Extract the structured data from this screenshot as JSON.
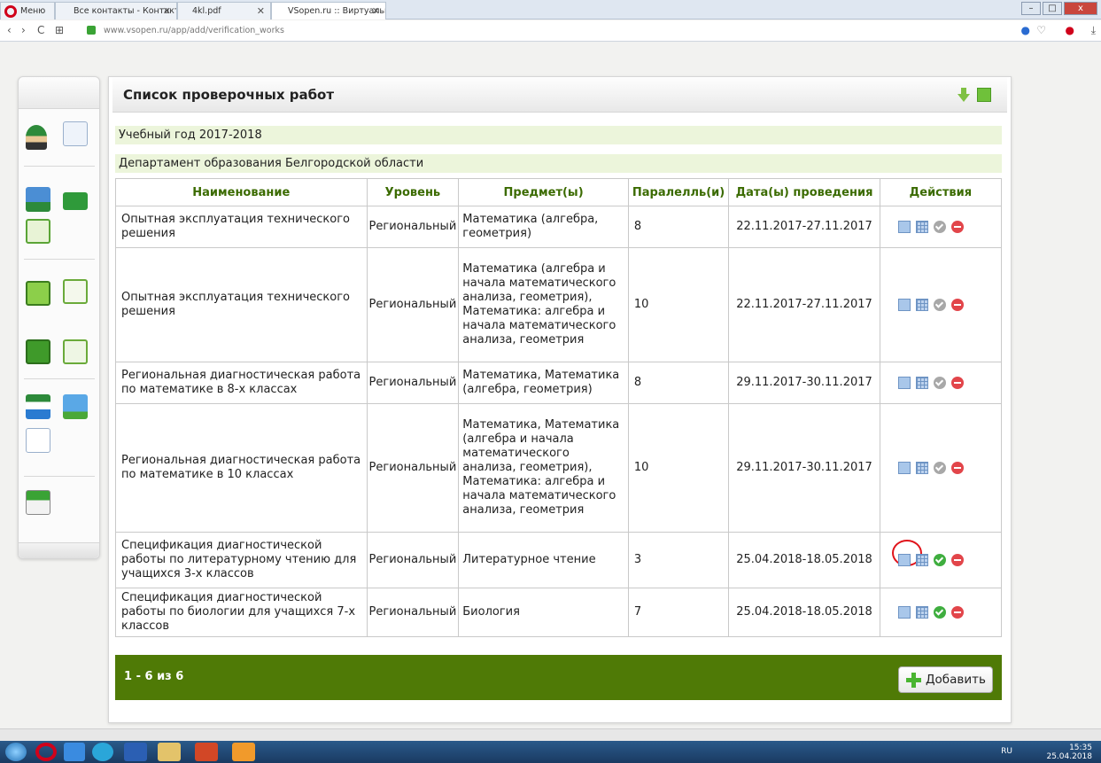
{
  "browser": {
    "tabs": [
      {
        "label": "Меню"
      },
      {
        "label": "Все контакты - Контакты"
      },
      {
        "label": "4kl.pdf"
      },
      {
        "label": "VSopen.ru :: Виртуальная"
      }
    ],
    "url": "www.vsopen.ru/app/add/verification_works"
  },
  "panel": {
    "title": "Список проверочных работ",
    "year_label": "Учебный год 2017-2018",
    "department": "Департамент образования Белгородской области"
  },
  "table": {
    "headers": [
      "Наименование",
      "Уровень",
      "Предмет(ы)",
      "Паралелль(и)",
      "Дата(ы) проведения",
      "Действия"
    ],
    "rows": [
      {
        "name": "Опытная эксплуатация технического решения",
        "level": "Региональный",
        "subjects": "Математика (алгебра, геометрия)",
        "parallel": "8",
        "dates": "22.11.2017-27.11.2017",
        "approved": false
      },
      {
        "name": "Опытная эксплуатация технического решения",
        "level": "Региональный",
        "subjects": "Математика (алгебра и начала математического анализа, геометрия), Математика: алгебра и начала математического анализа, геометрия",
        "parallel": "10",
        "dates": "22.11.2017-27.11.2017",
        "approved": false
      },
      {
        "name": "Региональная диагностическая работа по математике в 8-х классах",
        "level": "Региональный",
        "subjects": "Математика, Математика (алгебра, геометрия)",
        "parallel": "8",
        "dates": "29.11.2017-30.11.2017",
        "approved": false
      },
      {
        "name": "Региональная диагностическая работа по математике в 10 классах",
        "level": "Региональный",
        "subjects": "Математика, Математика (алгебра и начала математического анализа, геометрия), Математика: алгебра и начала математического анализа, геометрия",
        "parallel": "10",
        "dates": "29.11.2017-30.11.2017",
        "approved": false
      },
      {
        "name": "Спецификация диагностической работы по литературному чтению для учащихся 3-х классов",
        "level": "Региональный",
        "subjects": "Литературное чтение",
        "parallel": "3",
        "dates": "25.04.2018-18.05.2018",
        "approved": true
      },
      {
        "name": "Спецификация диагностической работы по биологии для учащихся 7-х классов",
        "level": "Региональный",
        "subjects": "Биология",
        "parallel": "7",
        "dates": "25.04.2018-18.05.2018",
        "approved": true
      }
    ]
  },
  "footer": {
    "pager": "1 - 6 из 6",
    "add_label": "Добавить"
  },
  "taskbar": {
    "lang": "RU",
    "time": "15:35",
    "date": "25.04.2018"
  },
  "colors": {
    "accent_green": "#4f7a06",
    "header_text": "#3b6b00",
    "info_bar": "#ecf5db",
    "annotation_red": "#e0141b"
  }
}
